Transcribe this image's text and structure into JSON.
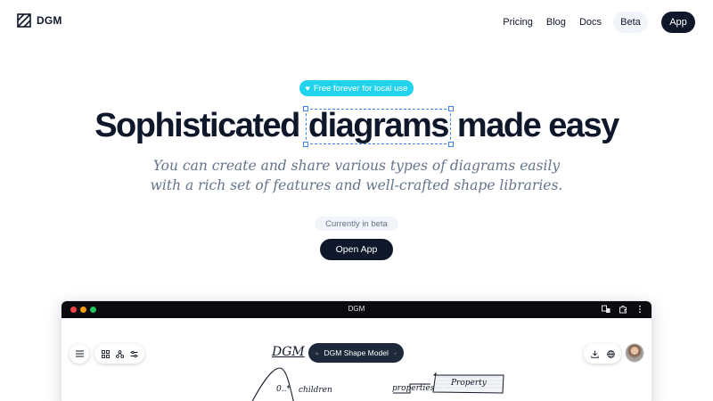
{
  "nav": {
    "logo_text": "DGM",
    "links": {
      "pricing": "Pricing",
      "blog": "Blog",
      "docs": "Docs"
    },
    "beta_label": "Beta",
    "app_label": "App"
  },
  "hero": {
    "badge": "Free forever for local use",
    "badge_icon": "heart-icon",
    "headline_before": "Sophisticated ",
    "headline_highlight": "diagrams",
    "headline_after": " made easy",
    "subtext_line1": "You can create and share various types of diagrams easily",
    "subtext_line2": "with a rich set of features and well-crafted shape libraries.",
    "beta_note": "Currently in beta",
    "cta_label": "Open App"
  },
  "app_window": {
    "title": "DGM",
    "doc_title": "DGM",
    "model_label": "DGM Shape Model",
    "canvas_texts": {
      "multiplicity": "0..*",
      "children": "children",
      "properties": "properties",
      "property_box": "Property"
    }
  },
  "colors": {
    "primary": "#0f172a",
    "accent_cyan": "#22d3ee",
    "selection_blue": "#3b82f6",
    "muted_text": "#64748b",
    "pill_bg": "#f1f5f9"
  }
}
